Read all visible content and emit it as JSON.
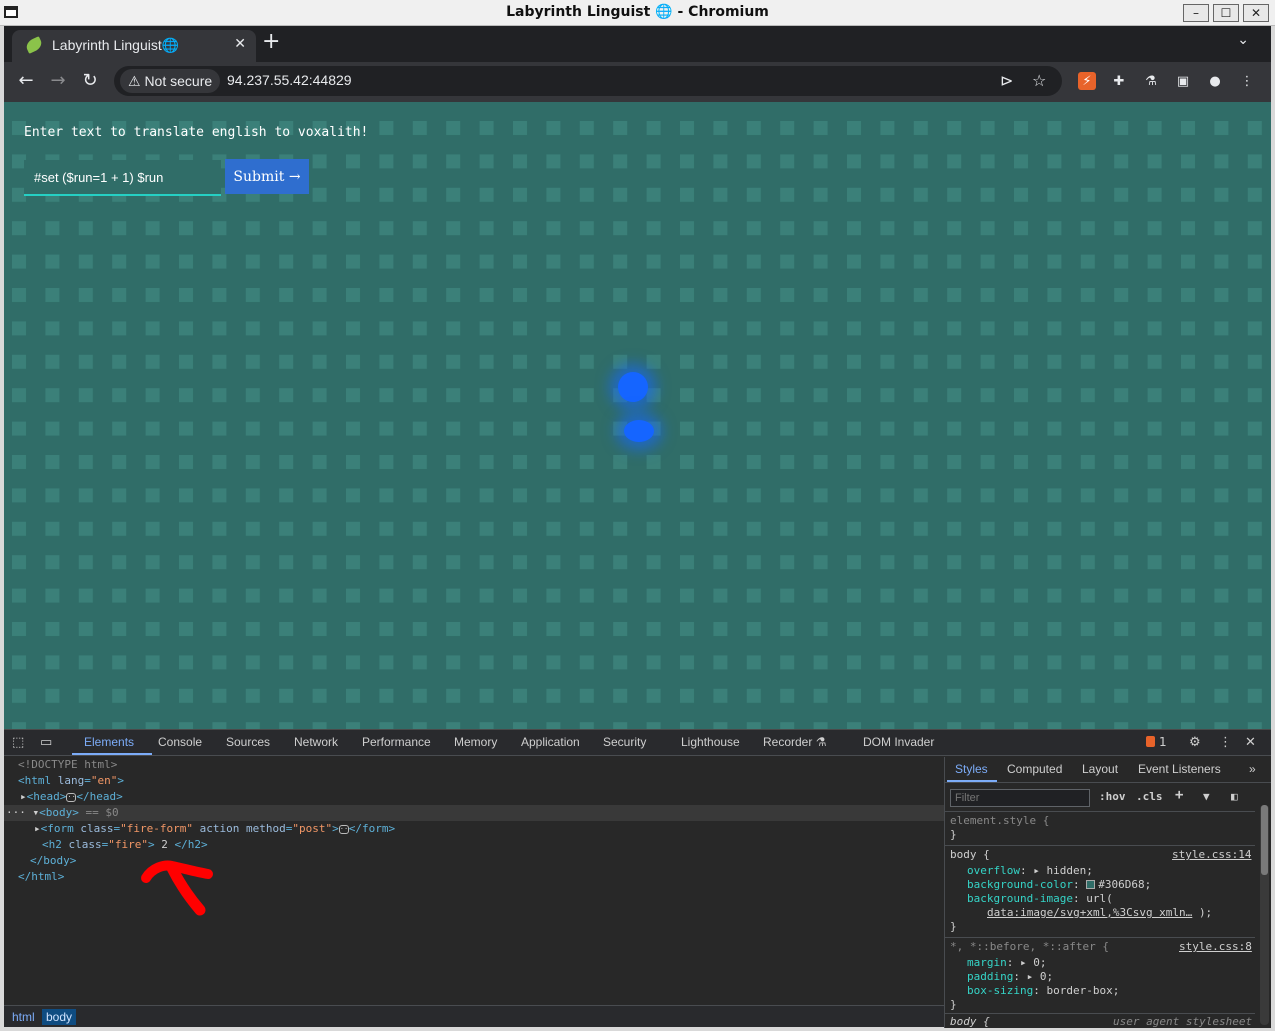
{
  "window": {
    "title": "Labyrinth Linguist 🌐 - Chromium",
    "min": "–",
    "max": "☐",
    "close": "✕"
  },
  "tab": {
    "title": "Labyrinth Linguist🌐",
    "close": "✕",
    "new": "+",
    "menu": "⌄"
  },
  "toolbar": {
    "back": "←",
    "forward": "→",
    "reload": "↻",
    "security_label": "⚠ Not secure",
    "url": "94.237.55.42:44829",
    "share": "⊳",
    "bookmark": "☆",
    "extensions": [
      "⚡",
      "✚",
      "⚗",
      "▣",
      "●",
      "⋮"
    ]
  },
  "page": {
    "prompt": "Enter text to translate english to voxalith!",
    "input_value": "#set ($run=1 + 1) $run",
    "submit_label": "Submit →",
    "bg_color": "#306D68"
  },
  "devtools": {
    "tabs": [
      "Elements",
      "Console",
      "Sources",
      "Network",
      "Performance",
      "Memory",
      "Application",
      "Security",
      "Lighthouse",
      "Recorder ⚗",
      "DOM Invader"
    ],
    "issues_count": "1",
    "dom": {
      "doctype": "<!DOCTYPE html>",
      "html_open_tag": "<html",
      "html_lang_attr": "lang",
      "html_lang_val": "\"en\"",
      "head": "<head>",
      "head_close": "</head>",
      "body_open": "<body>",
      "selected_marker": "== $0",
      "form_open": "<form",
      "form_class_attr": "class",
      "form_class_val": "\"fire-form\"",
      "form_action_attr": "action",
      "form_method_attr": "method",
      "form_method_val": "\"post\"",
      "form_close": "</form>",
      "h2_open": "<h2",
      "h2_class_attr": "class",
      "h2_class_val": "\"fire\"",
      "h2_text": " 2 ",
      "h2_close": "</h2>",
      "body_close": "</body>",
      "html_close": "</html>"
    },
    "breadcrumbs": [
      "html",
      "body"
    ],
    "styles": {
      "tabs": [
        "Styles",
        "Computed",
        "Layout",
        "Event Listeners",
        "»"
      ],
      "filter_placeholder": "Filter",
      "hov": ":hov",
      "cls": ".cls",
      "element_style": "element.style {",
      "close_brace": "}",
      "body_selector": "body {",
      "body_source": "style.css:14",
      "overflow_prop": "overflow",
      "overflow_val": "hidden;",
      "bg_color_prop": "background-color",
      "bg_color_val": "#306D68;",
      "bg_image_prop": "background-image",
      "bg_image_val": "url(",
      "bg_image_data": "data:image/svg+xml,%3Csvg xmln…",
      "bg_image_end": ");",
      "universal_selector": "*, *::before, *::after {",
      "universal_source": "style.css:8",
      "margin_prop": "margin",
      "margin_val": "0;",
      "padding_prop": "padding",
      "padding_val": "0;",
      "boxsizing_prop": "box-sizing",
      "boxsizing_val": "border-box;",
      "ua_selector": "body {",
      "ua_source": "user agent stylesheet"
    }
  }
}
